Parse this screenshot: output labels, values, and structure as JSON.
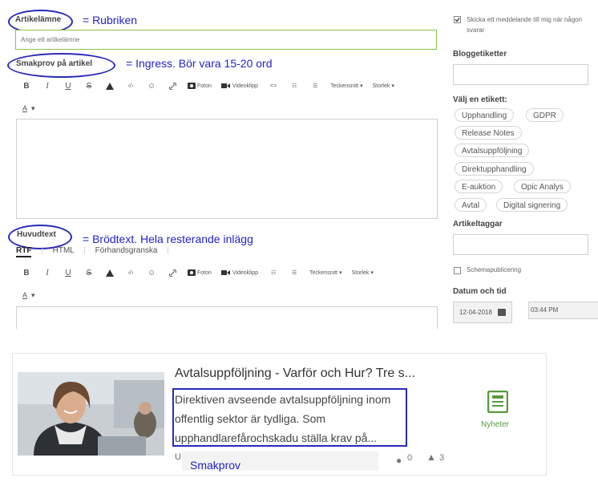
{
  "form": {
    "title_label": "Artikelämne",
    "title_annotation": "= Rubriken",
    "title_placeholder": "Ange ett artikelämne",
    "summary_label": "Smakprov på artikel",
    "summary_annotation": "= Ingress.  Bör vara 15-20 ord",
    "body_label": "Huvudtext",
    "body_annotation": "= Brödtext. Hela resterande inlägg",
    "body_tabs": [
      "RTF",
      "HTML",
      "Förhandsgranska"
    ],
    "toolbar": {
      "bold": "B",
      "italic": "I",
      "underline": "U",
      "strike": "S",
      "warning_icon": "warning-icon",
      "code": "‹/›",
      "emoji": "☺",
      "link": "🔗",
      "photo": "Foton",
      "video": "Videoklipp",
      "source": "<>",
      "ordered_list": "☷",
      "unordered_list": "☰",
      "font": "Teckensnitt",
      "size": "Storlek",
      "font_color": "A"
    }
  },
  "sidebar": {
    "notify_label": "Skicka ett meddelande till mig när någon svarar",
    "notify_checked": true,
    "blog_tags_label": "Bloggetiketter",
    "choose_tag_label": "Välj en etikett:",
    "tags": [
      "Upphandling",
      "GDPR",
      "Release Notes",
      "Avtalsuppföljning",
      "Direktupphandling",
      "E-auktion",
      "Opic Analys",
      "Avtal",
      "Digital signering"
    ],
    "article_tags_label": "Artikeltaggar",
    "schedule_label": "Schemapublicering",
    "schedule_checked": false,
    "datetime_label": "Datum och tid",
    "date_value": "12-04-2018",
    "time_value": "03:44 PM"
  },
  "preview": {
    "title": "Avtalsuppföljning - Varför och Hur? Tre s...",
    "excerpt_lines": [
      "Direktiven avseende avtalsuppföljning inom",
      "offentlig sektor är tydliga. Som",
      "upphandlarefårochskadu ställa krav på..."
    ],
    "category": "Nyheter",
    "author_initial": "U",
    "comments": "0",
    "likes": "3",
    "excerpt_annotation": "Smakprov"
  },
  "colors": {
    "annotation": "#2323c8",
    "focus_border": "#8bc34a"
  }
}
